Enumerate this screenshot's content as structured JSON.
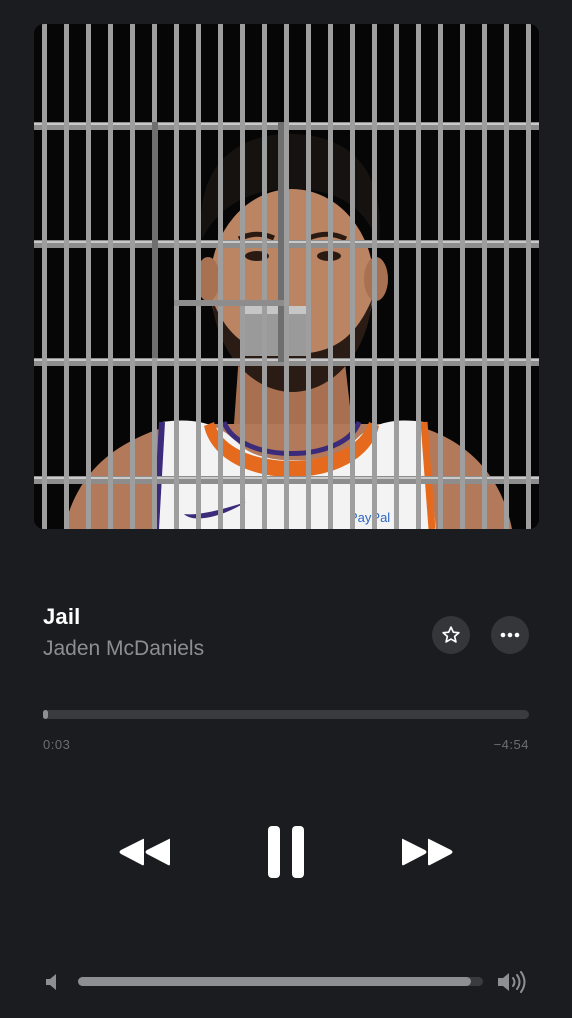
{
  "now_playing": {
    "title": "Jail",
    "artist": "Jaden McDaniels",
    "artwork": {
      "description_icon": "album-artwork-jail-bars",
      "jersey_sponsor_text": "PayPal"
    }
  },
  "actions": {
    "favorite_icon": "star-icon",
    "more_icon": "ellipsis-icon"
  },
  "playback": {
    "elapsed": "0:03",
    "remaining": "−4:54",
    "progress_fraction": 0.01
  },
  "controls": {
    "rewind_icon": "rewind-icon",
    "pause_icon": "pause-icon",
    "forward_icon": "fast-forward-icon"
  },
  "volume": {
    "level_fraction": 0.97,
    "low_icon": "volume-low-icon",
    "high_icon": "volume-high-icon"
  },
  "colors": {
    "background": "#1b1c1f",
    "secondary_text": "#8d8e93",
    "track": "#3a3b3f",
    "fill": "#8e8f93"
  }
}
